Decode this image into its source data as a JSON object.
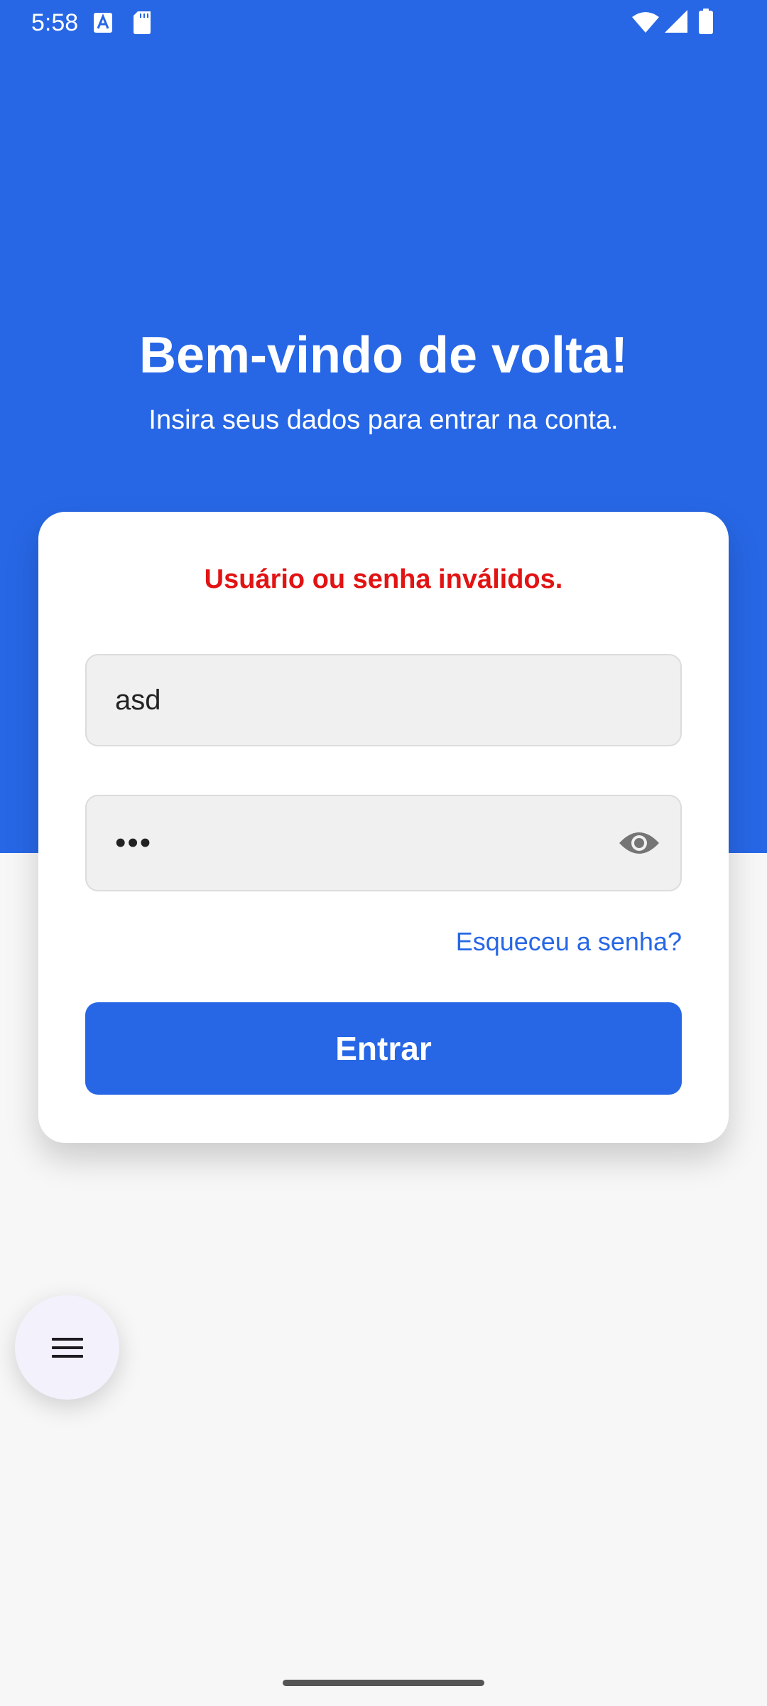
{
  "status_bar": {
    "time": "5:58",
    "icons": [
      "font-a-icon",
      "sd-card-icon",
      "wifi-icon",
      "signal-icon",
      "battery-icon"
    ]
  },
  "header": {
    "title": "Bem-vindo de volta!",
    "subtitle": "Insira seus dados para entrar na conta."
  },
  "login": {
    "error_message": "Usuário ou senha inválidos.",
    "username_value": "asd",
    "password_value": "asd",
    "forgot_password": "Esqueceu a senha?",
    "submit_label": "Entrar"
  },
  "fab": {
    "icon": "menu-icon"
  },
  "colors": {
    "primary": "#2767e6",
    "error": "#e21313",
    "background": "#f7f7f7",
    "card": "#ffffff"
  }
}
